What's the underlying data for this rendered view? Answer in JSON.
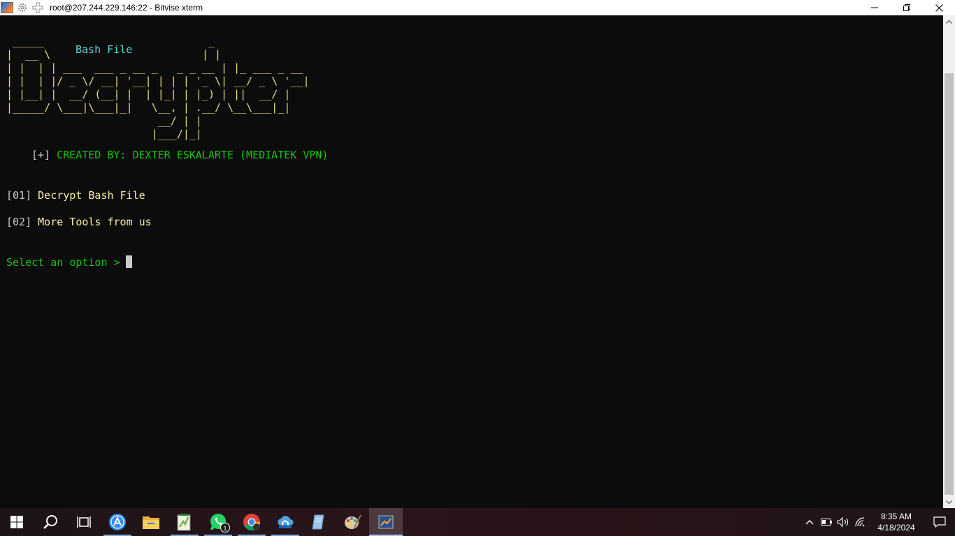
{
  "window": {
    "title": "root@207.244.229.146:22 - Bitvise xterm"
  },
  "terminal": {
    "art_lines": [
      " _____                          _",
      "|  __ \\                        | |",
      "| |  | | ___  ___ _ __ _   _ _ __ | |_ ___ _ __",
      "| |  | |/ _ \\/ __| '__| | | | '_ \\| __/ _ \\ '__|",
      "| |__| |  __/ (__| |  | |_| | |_) | ||  __/ |",
      "|_____/ \\___|\\___|_|   \\__, | .__/ \\__\\___|_|",
      "                        __/ | |",
      "                       |___/|_|"
    ],
    "art_label": "Bash File",
    "credit_bracket": "[+]",
    "credit_text": "CREATED BY: DEXTER ESKALARTE (MEDIATEK VPN)",
    "menu": [
      {
        "number": "[01]",
        "label": "Decrypt Bash File"
      },
      {
        "number": "[02]",
        "label": "More Tools from us"
      }
    ],
    "prompt": "Select an option >"
  },
  "colors": {
    "art": "#e8dc84",
    "label": "#61d6d6",
    "green": "#16c60c",
    "menu_text": "#f9f1a5"
  },
  "taskbar": {
    "apps": [
      {
        "name": "start-icon"
      },
      {
        "name": "search-icon"
      },
      {
        "name": "task-view-icon"
      },
      {
        "name": "app-store-icon"
      },
      {
        "name": "file-explorer-icon"
      },
      {
        "name": "notepad-plus-icon"
      },
      {
        "name": "whatsapp-icon",
        "badge": "1"
      },
      {
        "name": "chrome-icon"
      },
      {
        "name": "cloud-app-icon"
      },
      {
        "name": "document-app-icon"
      },
      {
        "name": "paint-icon"
      },
      {
        "name": "bitvise-icon"
      }
    ],
    "clock": {
      "time": "8:35 AM",
      "date": "4/18/2024"
    }
  }
}
